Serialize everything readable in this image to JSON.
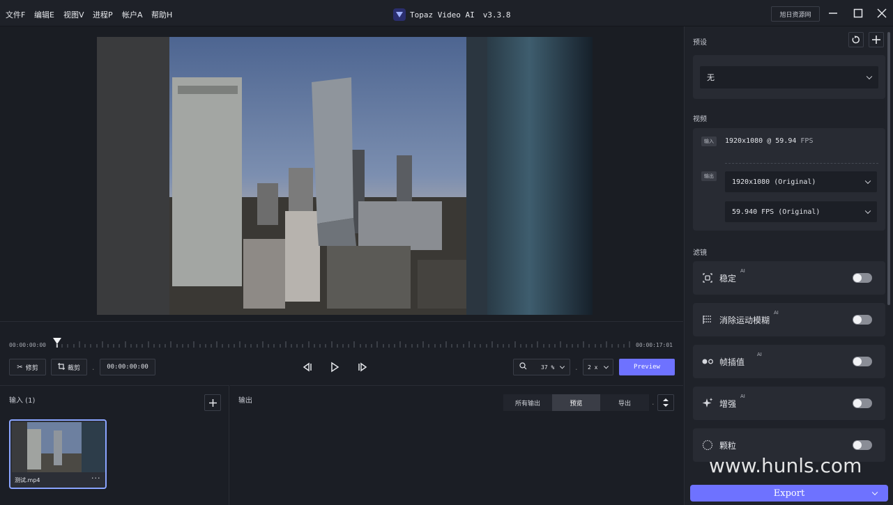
{
  "menu": {
    "items": [
      "文件F",
      "编辑E",
      "视图V",
      "进程P",
      "帐户A",
      "帮助H"
    ]
  },
  "app": {
    "title": "Topaz Video AI",
    "version": "v3.3.8",
    "resource_button": "旭日资源网"
  },
  "timeline": {
    "start_time": "00:00:00:00",
    "end_time": "00:00:17:01",
    "current_time": "00:00:00:00",
    "trim_label": "修剪",
    "crop_label": "裁剪",
    "zoom_value": "37 %",
    "speed_value": "2 x",
    "preview_label": "Preview"
  },
  "input": {
    "title": "输入 (1)",
    "file_name": "测试.mp4"
  },
  "output": {
    "title": "输出",
    "tabs": [
      "所有输出",
      "预览",
      "导出"
    ],
    "active_tab": "预览"
  },
  "sidebar": {
    "preset_title": "预设",
    "preset_value": "无",
    "video_title": "视频",
    "input_tag": "输入",
    "input_resolution": "1920x1080",
    "input_fps": "@ 59.94",
    "input_fps_unit": "FPS",
    "output_tag": "输出",
    "output_resolution": "1920x1080 (Original)",
    "output_fps": "59.940 FPS (Original)",
    "filters_title": "滤镜",
    "filters": [
      {
        "label": "稳定",
        "ai": "AI",
        "icon": "stabilize-icon",
        "enabled": false
      },
      {
        "label": "消除运动模糊",
        "ai": "AI",
        "icon": "motion-blur-icon",
        "enabled": false
      },
      {
        "label": "帧插值",
        "ai": "AI",
        "icon": "frame-interpolation-icon",
        "enabled": false
      },
      {
        "label": "增强",
        "ai": "AI",
        "icon": "enhance-icon",
        "enabled": false
      },
      {
        "label": "颗粒",
        "ai": "",
        "icon": "grain-icon",
        "enabled": false
      }
    ],
    "export_label": "Export"
  },
  "watermark": "www.hunls.com",
  "colors": {
    "accent": "#6e72ff",
    "background": "#1b1e25",
    "panel": "#282b33"
  }
}
